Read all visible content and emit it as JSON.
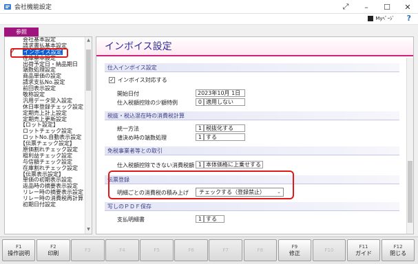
{
  "window": {
    "title": "会社機能設定",
    "my_page": "Myﾍﾟｰｼﾞ",
    "help": "?"
  },
  "nav": {
    "tab_label": "参照",
    "items": [
      {
        "label": "会社基本設定",
        "indent": 1
      },
      {
        "label": "請求書払基本設定",
        "indent": 1
      },
      {
        "label": "インボイス設定",
        "indent": 1,
        "selected": true
      },
      {
        "label": "在庫基本設定",
        "indent": 1
      },
      {
        "label": "出荷予定日・納品期日",
        "indent": 1
      },
      {
        "label": "端数処理設定",
        "indent": 1
      },
      {
        "label": "商品単価の設定",
        "indent": 1
      },
      {
        "label": "請求支払No.設定",
        "indent": 1
      },
      {
        "label": "前回表示設定",
        "indent": 1
      },
      {
        "label": "敬称設定",
        "indent": 1
      },
      {
        "label": "汎用データ受入設定",
        "indent": 1
      },
      {
        "label": "休日率登録チェック設定",
        "indent": 1
      },
      {
        "label": "定期売上計上設定",
        "indent": 1
      },
      {
        "label": "定期売上更新設定",
        "indent": 1
      },
      {
        "label": "【ロット設定】",
        "indent": 0
      },
      {
        "label": "ロットチェック設定",
        "indent": 1
      },
      {
        "label": "ロットNo.自動表示設定",
        "indent": 1
      },
      {
        "label": "【伝票チェック設定】",
        "indent": 0
      },
      {
        "label": "原価割れチェック設定",
        "indent": 1
      },
      {
        "label": "粗利益チェック設定",
        "indent": 1
      },
      {
        "label": "与信額チェック設定",
        "indent": 1
      },
      {
        "label": "在庫割れチェック設定",
        "indent": 1
      },
      {
        "label": "【伝票表示設定】",
        "indent": 0
      },
      {
        "label": "単価の初期表示設定",
        "indent": 1
      },
      {
        "label": "返品時の摘要表示設定",
        "indent": 1
      },
      {
        "label": "リレー時の摘要表示設定",
        "indent": 1
      },
      {
        "label": "リレー時の消費税再計算",
        "indent": 1
      },
      {
        "label": "初期日付設定",
        "indent": 1
      }
    ]
  },
  "page_title": "インボイス設定",
  "sections": {
    "purchase": {
      "title": "仕入インボイス設定",
      "checkbox_label": "インボイス対応する",
      "checkbox_checked": true,
      "start_date_label": "開始日付",
      "start_date_value": "2023年10月 1日",
      "small_deduction_label": "仕入税額控除の少額特例",
      "small_deduction_code": "0",
      "small_deduction_value": "適用しない"
    },
    "tax_mixed": {
      "title": "税抜・税込混在時の消費税計算",
      "unify_label": "統一方法",
      "unify_code": "1",
      "unify_value": "税抜化する",
      "rounding_label": "値決め時の端数処理",
      "rounding_code": "1",
      "rounding_value": "する"
    },
    "exempt": {
      "title": "免税事業者等との取引",
      "label": "仕入税額控除できない消費税額",
      "code": "1",
      "value": "本体価格に上乗せする"
    },
    "slip": {
      "title": "伝票登録",
      "label": "明細ごとの消費税の積み上げ",
      "value": "チェックする（登録禁止）"
    },
    "pdf": {
      "title": "写しのＰＤＦ保存",
      "label": "支払明細書",
      "code": "1",
      "value": "する"
    }
  },
  "fkeys": [
    {
      "key": "F1",
      "label": "操作説明",
      "enabled": true
    },
    {
      "key": "F2",
      "label": "印刷",
      "enabled": true
    },
    {
      "key": "F3",
      "label": "",
      "enabled": false
    },
    {
      "key": "F4",
      "label": "",
      "enabled": false
    },
    {
      "key": "F5",
      "label": "",
      "enabled": false
    },
    {
      "key": "F6",
      "label": "",
      "enabled": false
    },
    {
      "key": "F7",
      "label": "",
      "enabled": false
    },
    {
      "key": "F8",
      "label": "",
      "enabled": false
    },
    {
      "key": "F9",
      "label": "修正",
      "enabled": true
    },
    {
      "key": "F10",
      "label": "",
      "enabled": false
    },
    {
      "key": "F11",
      "label": "ガイド",
      "enabled": true
    },
    {
      "key": "F12",
      "label": "閉じる",
      "enabled": true
    }
  ],
  "colors": {
    "accent": "#a0157d",
    "title": "#2b2e9a",
    "highlight": "#e01818",
    "selected": "#0b5bd3"
  }
}
